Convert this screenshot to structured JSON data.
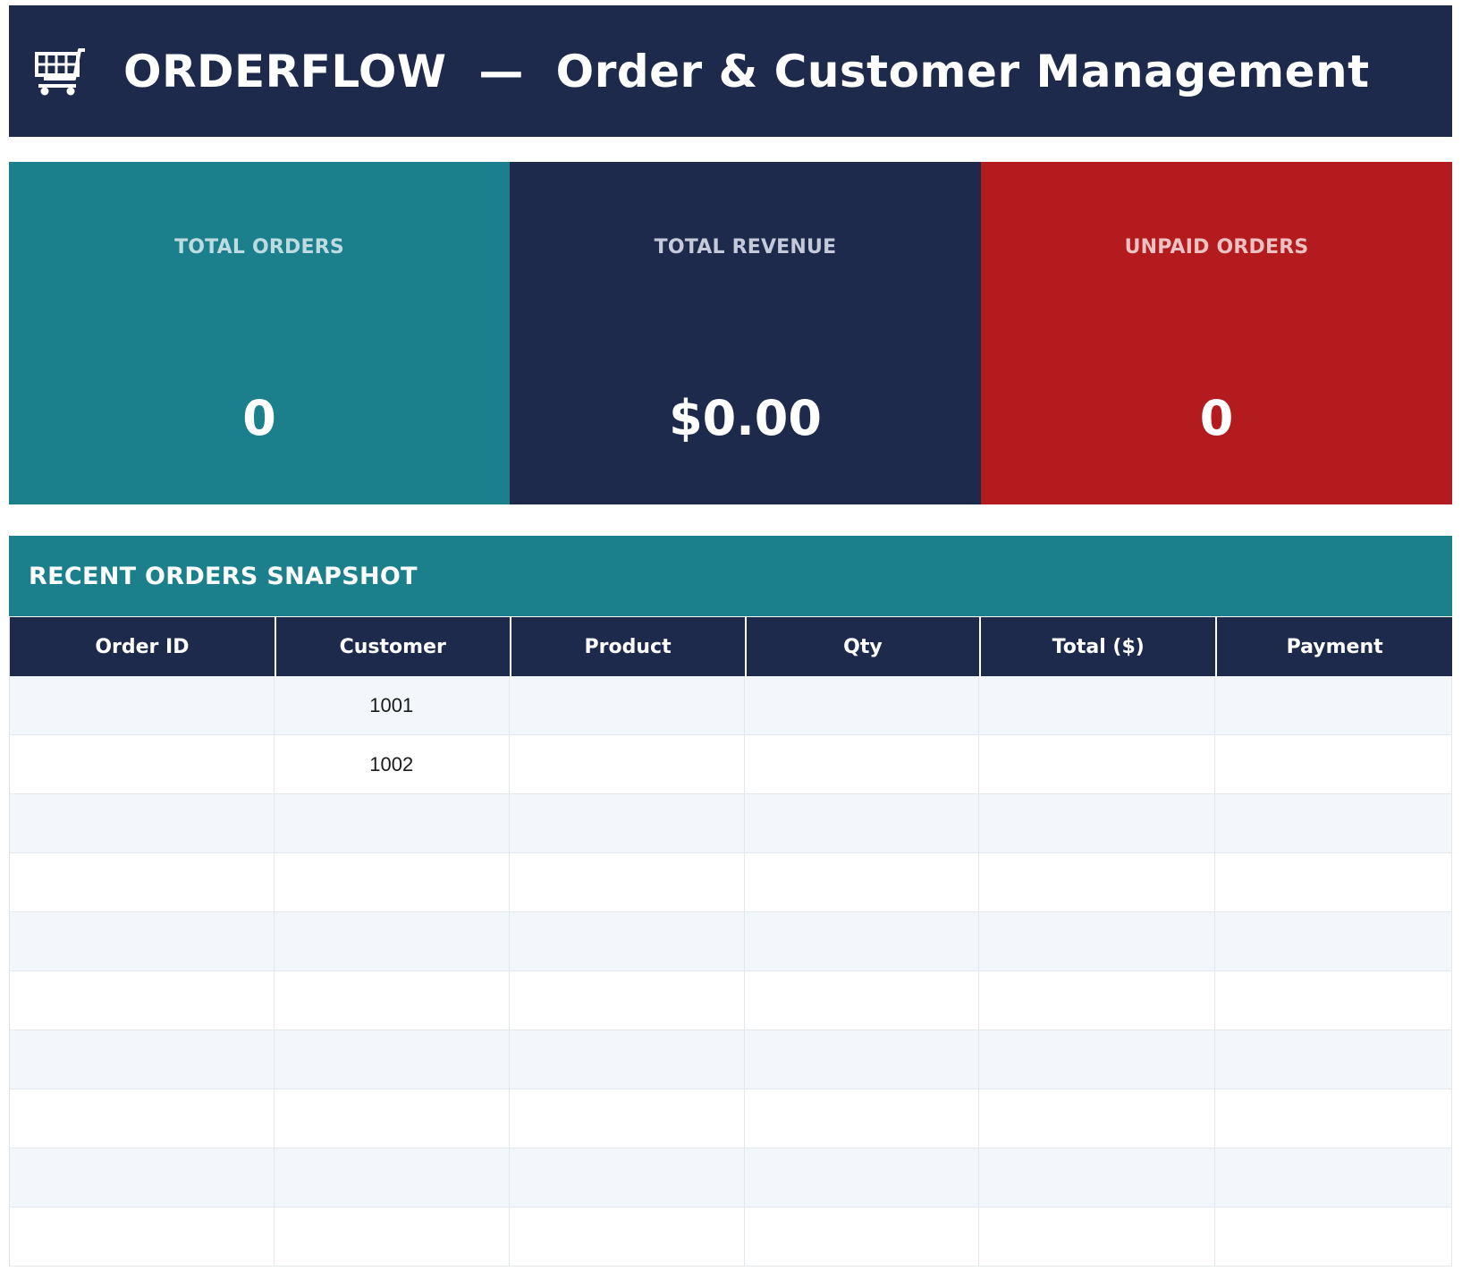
{
  "header": {
    "icon": "shopping-cart-icon",
    "title": "ORDERFLOW  —  Order & Customer Management"
  },
  "kpis": [
    {
      "label": "TOTAL ORDERS",
      "value": "0",
      "color": "#1b7f8c"
    },
    {
      "label": "TOTAL REVENUE",
      "value": "$0.00",
      "color": "#1d2a4c"
    },
    {
      "label": "UNPAID ORDERS",
      "value": "0",
      "color": "#b31b1e"
    }
  ],
  "section": {
    "title": "RECENT ORDERS SNAPSHOT"
  },
  "table": {
    "columns": [
      "Order ID",
      "Customer",
      "Product",
      "Qty",
      "Total ($)",
      "Payment"
    ],
    "rows": [
      [
        "",
        "1001",
        "",
        "",
        "",
        ""
      ],
      [
        "",
        "1002",
        "",
        "",
        "",
        ""
      ],
      [
        "",
        "",
        "",
        "",
        "",
        ""
      ],
      [
        "",
        "",
        "",
        "",
        "",
        ""
      ],
      [
        "",
        "",
        "",
        "",
        "",
        ""
      ],
      [
        "",
        "",
        "",
        "",
        "",
        ""
      ],
      [
        "",
        "",
        "",
        "",
        "",
        ""
      ],
      [
        "",
        "",
        "",
        "",
        "",
        ""
      ],
      [
        "",
        "",
        "",
        "",
        "",
        ""
      ],
      [
        "",
        "",
        "",
        "",
        "",
        ""
      ]
    ]
  },
  "colors": {
    "navy": "#1d2a4c",
    "teal": "#1b7f8c",
    "red": "#b31b1e",
    "row_alt": "#f3f6fa"
  }
}
